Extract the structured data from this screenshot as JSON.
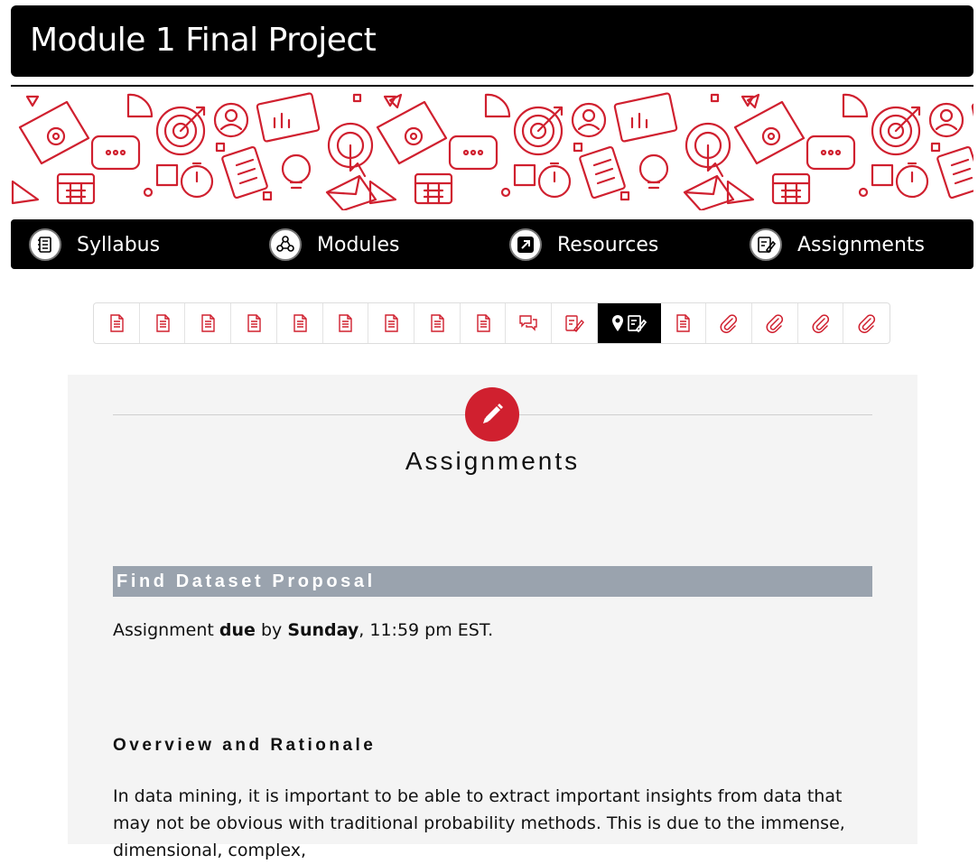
{
  "page_title": "Module 1 Final Project",
  "nav": {
    "items": [
      {
        "label": "Syllabus",
        "icon": "syllabus-icon"
      },
      {
        "label": "Modules",
        "icon": "modules-icon"
      },
      {
        "label": "Resources",
        "icon": "resources-icon"
      },
      {
        "label": "Assignments",
        "icon": "assignments-icon"
      }
    ]
  },
  "page_nav": {
    "items": [
      "page",
      "page",
      "page",
      "page",
      "page",
      "page",
      "page",
      "page",
      "page",
      "discussion",
      "assignment",
      "current-assignment",
      "page",
      "attachment",
      "attachment",
      "attachment",
      "attachment"
    ],
    "current_index": 11
  },
  "colors": {
    "accent": "#d0202f",
    "bar": "#9aa3ae",
    "banner_art": "#d0202f"
  },
  "section": {
    "title": "Assignments",
    "icon": "pencil-icon"
  },
  "assignment": {
    "heading": "Find Dataset Proposal",
    "due_prefix": "Assignment ",
    "due_word": "due",
    "due_by": " by ",
    "due_day": "Sunday",
    "due_time": ", 11:59 pm EST."
  },
  "overview": {
    "heading": "Overview and Rationale",
    "paragraph": "In data mining, it is important to be able to extract important insights from data that may not be obvious with traditional probability methods. This is due to the immense, dimensional, complex,"
  }
}
